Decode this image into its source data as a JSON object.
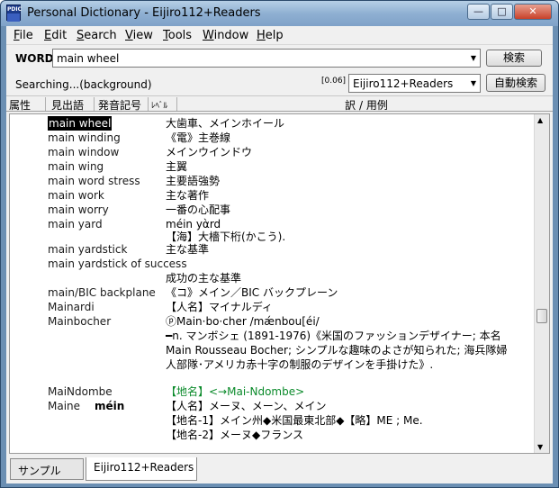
{
  "window": {
    "title": "Personal Dictionary - Eijiro112+Readers",
    "minimize": "—",
    "maximize": "□",
    "close": "✕"
  },
  "menu": [
    "File",
    "Edit",
    "Search",
    "View",
    "Tools",
    "Window",
    "Help"
  ],
  "toolbar": {
    "word_label": "WORD",
    "word_value": "main wheel",
    "search_button": "検索"
  },
  "status": {
    "text": "Searching...(background)",
    "timing": "[0.06]",
    "dictionary": "Eijiro112+Readers",
    "auto_search_button": "自動検索"
  },
  "columns": {
    "attr": "属性",
    "headword": "見出語",
    "pronunciation": "発音記号",
    "level": "ﾚﾍﾞﾙ",
    "translation": "訳 / 用例"
  },
  "entries": [
    {
      "headword": "main wheel",
      "translation": "大歯車、メインホイール"
    },
    {
      "headword": "main winding",
      "translation": "《電》主巻線"
    },
    {
      "headword": "main window",
      "translation": "メインウインドウ"
    },
    {
      "headword": "main wing",
      "translation": "主翼"
    },
    {
      "headword": "main word stress",
      "translation": "主要語強勢"
    },
    {
      "headword": "main work",
      "translation": "主な著作"
    },
    {
      "headword": "main worry",
      "translation": "一番の心配事"
    },
    {
      "headword": "main yard",
      "translation": "méin yὰrd"
    },
    {
      "headword": "",
      "translation": "【海】大檣下桁(かこう)."
    },
    {
      "headword": "main yardstick",
      "translation": "主な基準"
    },
    {
      "headword": "main yardstick of success",
      "translation": ""
    },
    {
      "headword": "",
      "translation": "成功の主な基準"
    },
    {
      "headword": "main/BIC backplane",
      "translation": "《コ》メイン／BIC バックプレーン"
    },
    {
      "headword": "Mainardi",
      "translation": "【人名】マイナルディ"
    },
    {
      "headword": "Mainbocher",
      "translation": "ⓟMain·bo·cher /mǽnbou[éi/"
    },
    {
      "headword": "",
      "translation": "━n. マンボシェ (1891-1976)《米国のファッションデザイナー; 本名"
    },
    {
      "headword": "",
      "translation": "Main Rousseau Bocher; シンプルな趣味のよさが知られた; 海兵隊婦"
    },
    {
      "headword": "",
      "translation": "人部隊･アメリカ赤十字の制服のデザインを手掛けた》."
    },
    {
      "headword": "MaiNdombe",
      "translation": "【地名】<→Mai-Ndombe>"
    },
    {
      "headword": "Maine",
      "pronunciation": "méin",
      "translation": "【人名】メーヌ、メーン、メイン"
    },
    {
      "headword": "",
      "translation": "【地名-1】メイン州◆米国最東北部◆【略】ME ; Me."
    },
    {
      "headword": "",
      "translation": "【地名-2】メーヌ◆フランス"
    }
  ],
  "tabs": [
    "サンプル",
    "Eijiro112+Readers"
  ]
}
